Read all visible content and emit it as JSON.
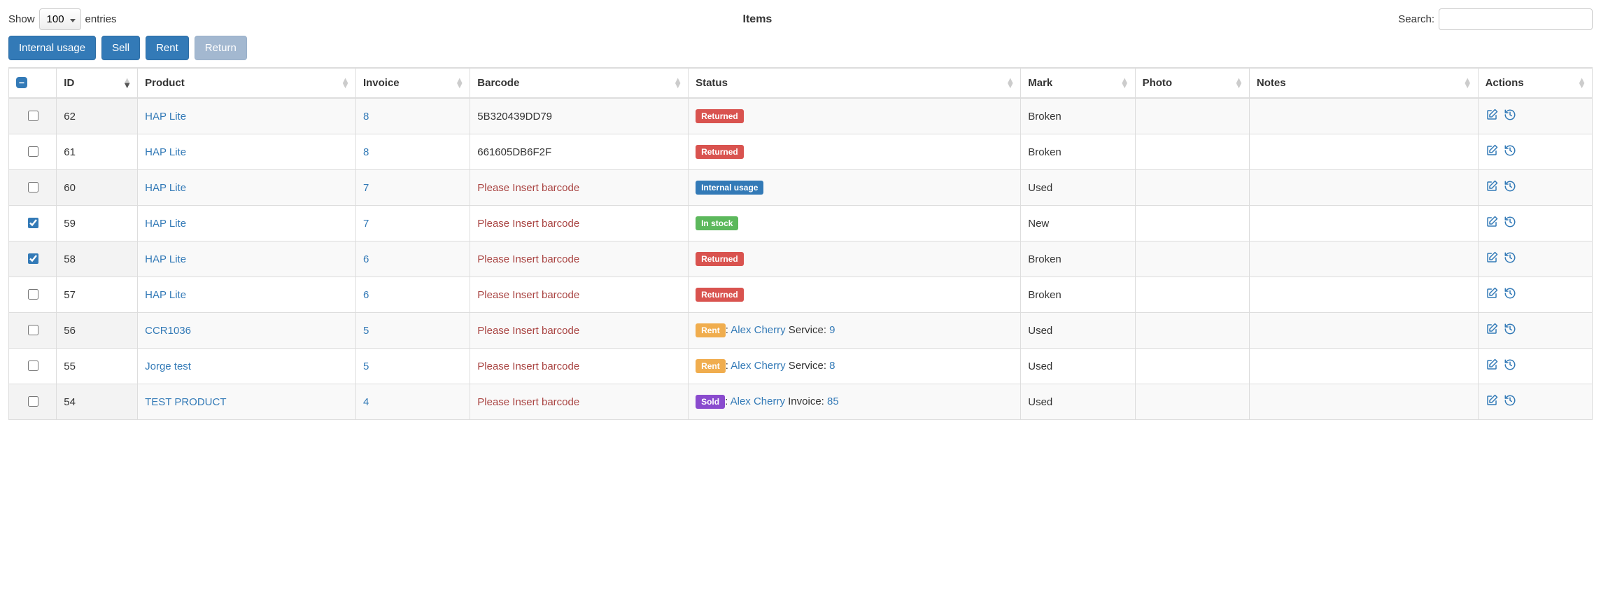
{
  "lengthMenu": {
    "prefix": "Show",
    "value": "100",
    "suffix": "entries"
  },
  "title": "Items",
  "search": {
    "label": "Search:",
    "value": ""
  },
  "buttons": {
    "internal": "Internal usage",
    "sell": "Sell",
    "rent": "Rent",
    "return": "Return"
  },
  "columns": {
    "id": "ID",
    "product": "Product",
    "invoice": "Invoice",
    "barcode": "Barcode",
    "status": "Status",
    "mark": "Mark",
    "photo": "Photo",
    "notes": "Notes",
    "actions": "Actions"
  },
  "badgeLabels": {
    "returned": "Returned",
    "internal": "Internal usage",
    "instock": "In stock",
    "rent": "Rent",
    "sold": "Sold"
  },
  "barcodePlaceholder": "Please Insert barcode",
  "rows": [
    {
      "checked": false,
      "id": "62",
      "product": "HAP Lite",
      "invoice": "8",
      "barcode": "5B320439DD79",
      "status": "returned",
      "mark": "Broken"
    },
    {
      "checked": false,
      "id": "61",
      "product": "HAP Lite",
      "invoice": "8",
      "barcode": "661605DB6F2F",
      "status": "returned",
      "mark": "Broken"
    },
    {
      "checked": false,
      "id": "60",
      "product": "HAP Lite",
      "invoice": "7",
      "barcode": "",
      "status": "internal",
      "mark": "Used"
    },
    {
      "checked": true,
      "id": "59",
      "product": "HAP Lite",
      "invoice": "7",
      "barcode": "",
      "status": "instock",
      "mark": "New"
    },
    {
      "checked": true,
      "id": "58",
      "product": "HAP Lite",
      "invoice": "6",
      "barcode": "",
      "status": "returned",
      "mark": "Broken"
    },
    {
      "checked": false,
      "id": "57",
      "product": "HAP Lite",
      "invoice": "6",
      "barcode": "",
      "status": "returned",
      "mark": "Broken"
    },
    {
      "checked": false,
      "id": "56",
      "product": "CCR1036",
      "invoice": "5",
      "barcode": "",
      "status": "rent",
      "customer": "Alex Cherry",
      "refLabel": "Service:",
      "refValue": "9",
      "mark": "Used"
    },
    {
      "checked": false,
      "id": "55",
      "product": "Jorge test",
      "invoice": "5",
      "barcode": "",
      "status": "rent",
      "customer": "Alex Cherry",
      "refLabel": "Service:",
      "refValue": "8",
      "mark": "Used"
    },
    {
      "checked": false,
      "id": "54",
      "product": "TEST PRODUCT",
      "invoice": "4",
      "barcode": "",
      "status": "sold",
      "customer": "Alex Cherry",
      "refLabel": "Invoice:",
      "refValue": "85",
      "mark": "Used"
    }
  ]
}
